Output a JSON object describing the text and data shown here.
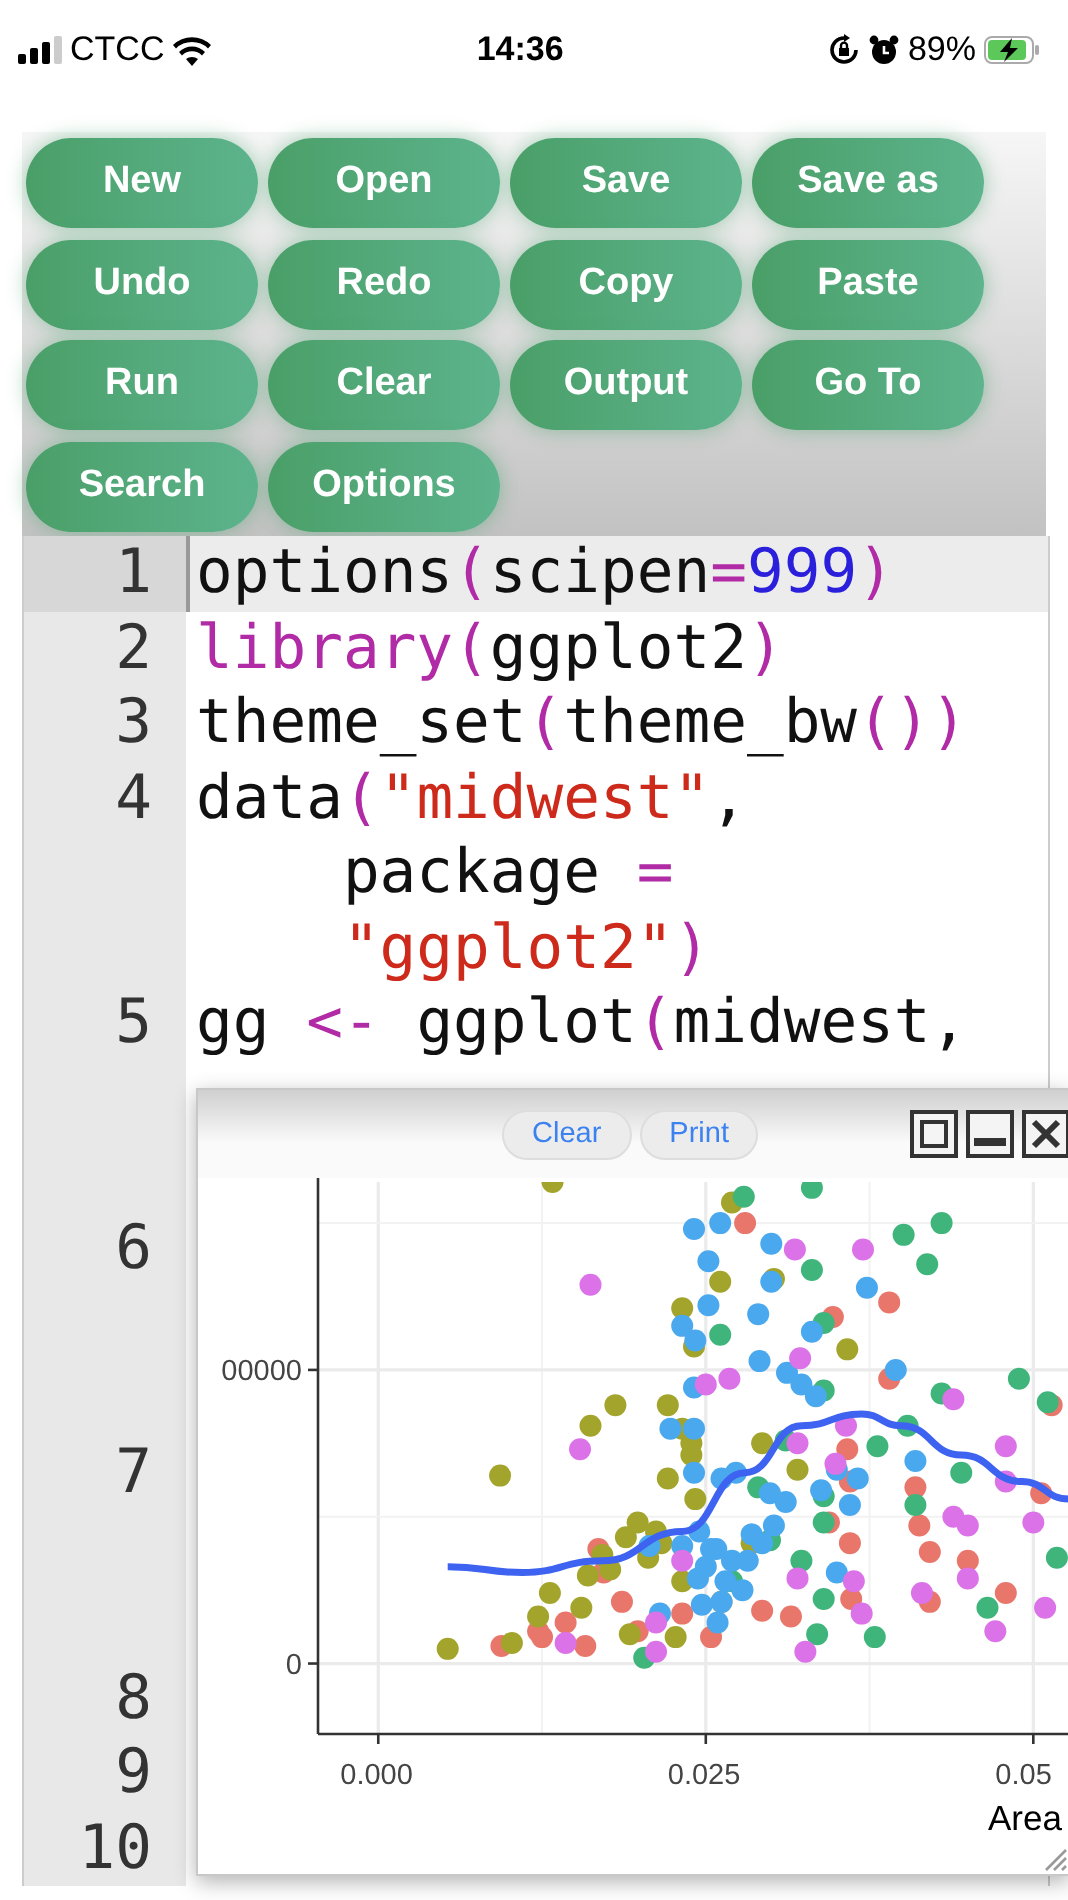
{
  "status_bar": {
    "carrier": "CTCC",
    "time": "14:36",
    "battery": "89%"
  },
  "toolbar": {
    "buttons": [
      "New",
      "Open",
      "Save",
      "Save as",
      "Undo",
      "Redo",
      "Copy",
      "Paste",
      "Run",
      "Clear",
      "Output",
      "Go To",
      "Search",
      "Options"
    ]
  },
  "editor": {
    "lines": [
      {
        "number": "1",
        "selected": true,
        "tokens": [
          {
            "text": "options",
            "kind": "plain"
          },
          {
            "text": "(",
            "kind": "bracket"
          },
          {
            "text": "scipen",
            "kind": "plain"
          },
          {
            "text": "=",
            "kind": "operator"
          },
          {
            "text": "999",
            "kind": "number"
          },
          {
            "text": ")",
            "kind": "bracket"
          }
        ]
      },
      {
        "number": "2",
        "selected": false,
        "tokens": [
          {
            "text": "library",
            "kind": "keyword"
          },
          {
            "text": "(",
            "kind": "bracket"
          },
          {
            "text": "ggplot2",
            "kind": "plain"
          },
          {
            "text": ")",
            "kind": "bracket"
          }
        ]
      },
      {
        "number": "3",
        "selected": false,
        "tokens": [
          {
            "text": "theme_set",
            "kind": "plain"
          },
          {
            "text": "(",
            "kind": "bracket"
          },
          {
            "text": "theme_bw",
            "kind": "plain"
          },
          {
            "text": "())",
            "kind": "bracket"
          }
        ]
      },
      {
        "number": "4",
        "selected": false,
        "tokens": [
          {
            "text": "data",
            "kind": "plain"
          },
          {
            "text": "(",
            "kind": "bracket"
          },
          {
            "text": "\"midwest\"",
            "kind": "string"
          },
          {
            "text": ", package ",
            "kind": "plain"
          },
          {
            "text": "= ",
            "kind": "operator"
          },
          {
            "text": "\"ggplot2\"",
            "kind": "string"
          },
          {
            "text": ")",
            "kind": "bracket"
          }
        ]
      },
      {
        "number": "5",
        "selected": false,
        "tokens": [
          {
            "text": "gg ",
            "kind": "plain"
          },
          {
            "text": "<-",
            "kind": "operator"
          },
          {
            "text": " ggplot",
            "kind": "plain"
          },
          {
            "text": "(",
            "kind": "bracket"
          },
          {
            "text": "midwest,",
            "kind": "plain"
          }
        ]
      },
      {
        "number": "6",
        "selected": false
      },
      {
        "number": "7",
        "selected": false
      },
      {
        "number": "8",
        "selected": false
      },
      {
        "number": "9",
        "selected": false
      },
      {
        "number": "10",
        "selected": false
      }
    ]
  },
  "plot_window": {
    "buttons": [
      "Clear",
      "Print"
    ],
    "plot": {
      "y_tick_labels": [
        "00000",
        "0"
      ],
      "x_tick_labels": [
        "0.000",
        "0.025",
        "0.05"
      ],
      "x_axis_title": "Area"
    }
  }
}
